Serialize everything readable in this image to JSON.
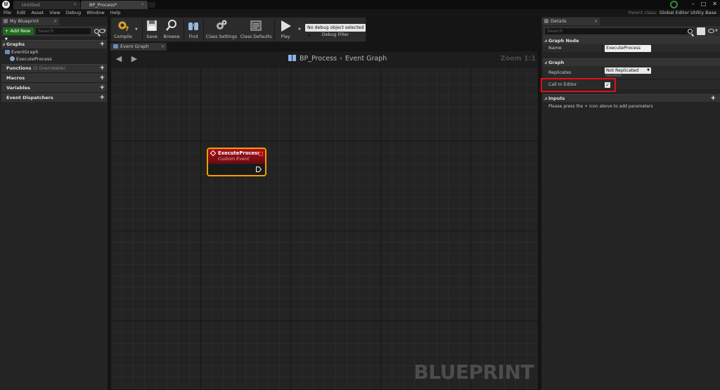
{
  "titlebar": {
    "logo": "U",
    "tabs": [
      {
        "label": "Untitled",
        "active": false
      },
      {
        "label": "BP_Process*",
        "active": true
      }
    ],
    "window_controls": [
      "minimize-icon",
      "maximize-icon",
      "close-icon"
    ]
  },
  "menu": {
    "items": [
      "File",
      "Edit",
      "Asset",
      "View",
      "Debug",
      "Window",
      "Help"
    ],
    "parent_class_label": "Parent class:",
    "parent_class_value": "Global Editor Utility Base"
  },
  "my_blueprint": {
    "tab_label": "My Blueprint",
    "add_new_label": "Add New",
    "search_placeholder": "Search",
    "sections": {
      "graphs": "Graphs",
      "functions": "Functions",
      "functions_sub": "(1 Overridable)",
      "macros": "Macros",
      "variables": "Variables",
      "event_dispatchers": "Event Dispatchers"
    },
    "tree": {
      "event_graph": "EventGraph",
      "execute_process": "ExecuteProcess"
    }
  },
  "toolbar": {
    "buttons": {
      "compile": "Compile",
      "save": "Save",
      "browse": "Browse",
      "find": "Find",
      "class_settings": "Class Settings",
      "class_defaults": "Class Defaults",
      "play": "Play"
    },
    "debug_select": "No debug object selected",
    "debug_filter_label": "Debug Filter"
  },
  "graph": {
    "tab_label": "Event Graph",
    "breadcrumb": {
      "blueprint": "BP_Process",
      "graph": "Event Graph"
    },
    "zoom": "Zoom 1:1",
    "watermark": "BLUEPRINT",
    "node": {
      "title": "ExecuteProcess",
      "subtitle": "Custom Event"
    }
  },
  "details": {
    "tab_label": "Details",
    "search_placeholder": "Search",
    "graph_node_section": "Graph Node",
    "name_label": "Name",
    "name_value": "ExecuteProcess",
    "graph_section": "Graph",
    "replicates_label": "Replicates",
    "replicates_value": "Not Replicated",
    "reliable_label": "Reliable",
    "call_in_editor_label": "Call In Editor",
    "call_in_editor_checked": true,
    "check_glyph": "✓",
    "inputs_section": "Inputs",
    "inputs_hint": "Please press the + icon above to add parameters"
  },
  "colors": {
    "accent_add": "#1f6a1f",
    "node_header": "#a8101a",
    "node_selected_border": "#f0a000",
    "highlight_box": "#e0101a"
  }
}
